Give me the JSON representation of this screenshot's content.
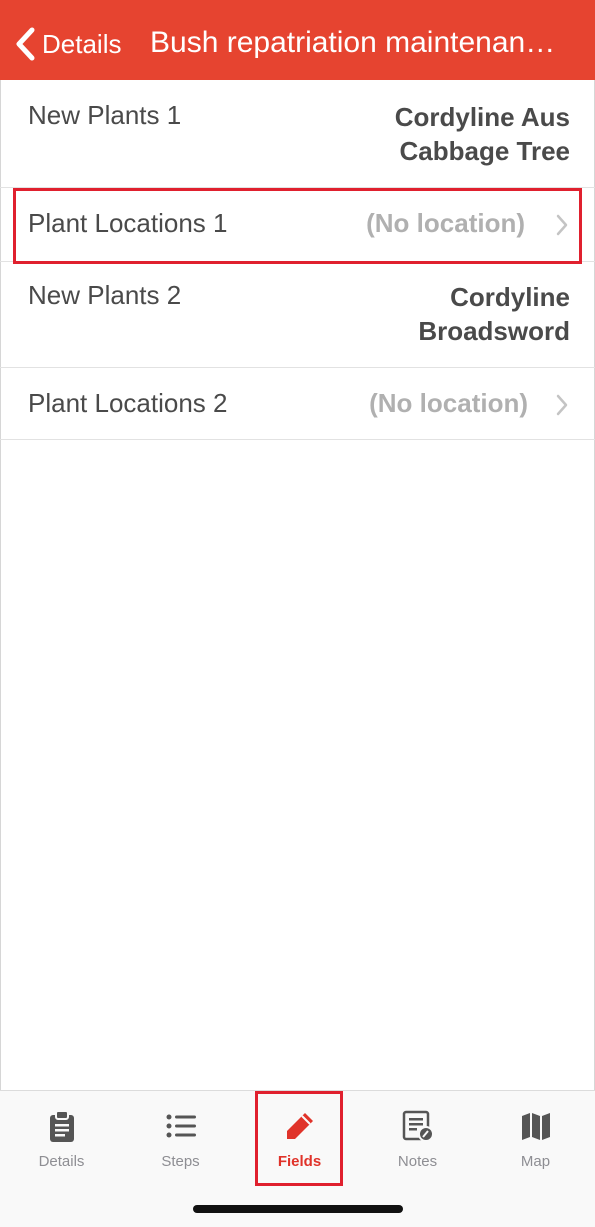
{
  "navbar": {
    "back_label": "Details",
    "title": "Bush repatriation maintenan…",
    "color": "#e64430"
  },
  "fields": [
    {
      "label": "New Plants 1",
      "value_lines": [
        "Cordyline Aus",
        "Cabbage Tree"
      ]
    },
    {
      "label": "Plant Locations 1",
      "value": "(No location)",
      "highlighted": true
    },
    {
      "label": "New Plants 2",
      "value_lines": [
        "Cordyline",
        "Broadsword"
      ]
    },
    {
      "label": "Plant Locations 2",
      "value": "(No location)"
    }
  ],
  "tabbar": {
    "tabs": [
      {
        "label": "Details",
        "icon": "clipboard-icon"
      },
      {
        "label": "Steps",
        "icon": "list-icon"
      },
      {
        "label": "Fields",
        "icon": "pencil-icon",
        "active": true
      },
      {
        "label": "Notes",
        "icon": "note-icon"
      },
      {
        "label": "Map",
        "icon": "map-icon"
      }
    ],
    "active_color": "#e0332a",
    "inactive_color": "#8e8e93"
  },
  "highlight_color": "#e0202e"
}
